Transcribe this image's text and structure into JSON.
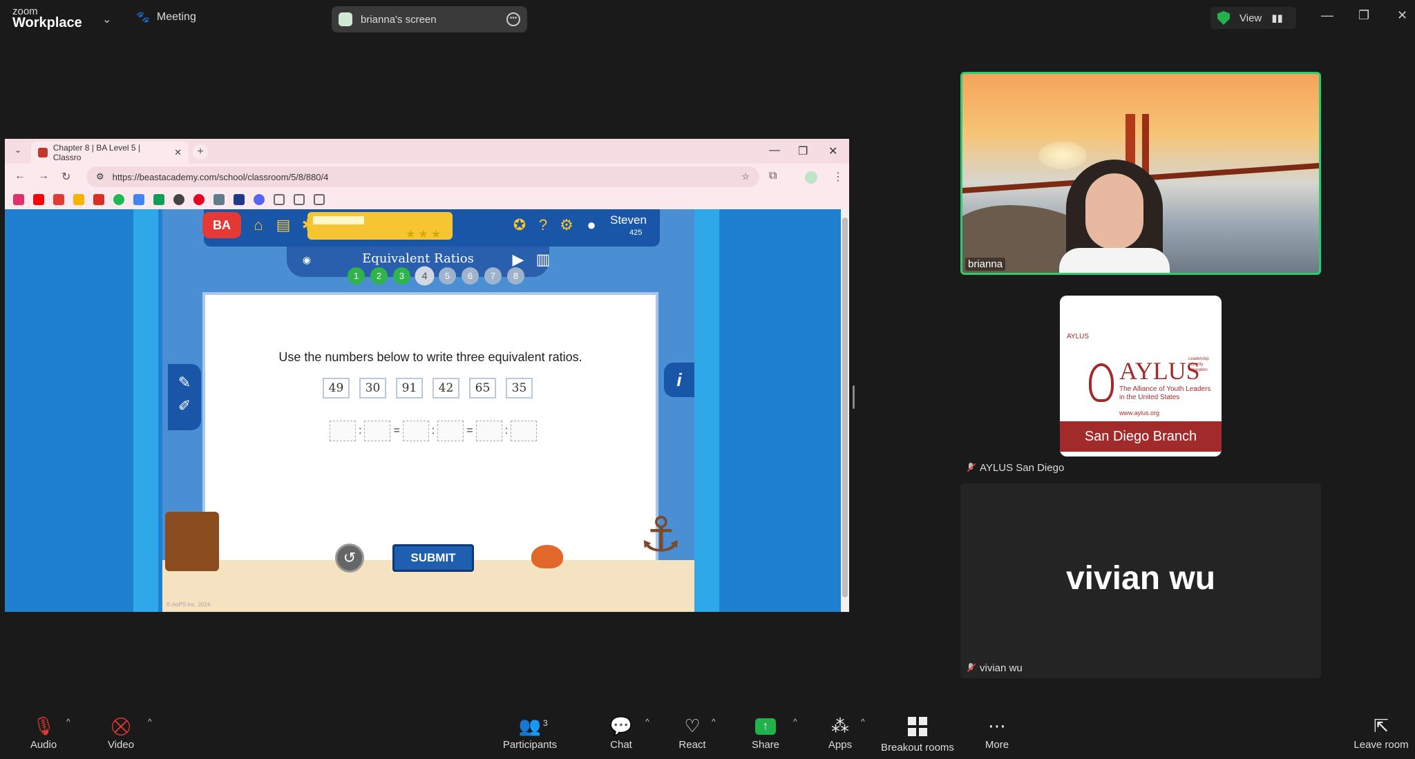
{
  "topbar": {
    "brand_small": "zoom",
    "brand_big": "Workplace",
    "meeting_label": "Meeting",
    "screen_label": "brianna's screen",
    "view_label": "View"
  },
  "browser": {
    "tab_title": "Chapter 8 | BA Level 5 | Classro",
    "url": "https://beastacademy.com/school/classroom/5/8/880/4"
  },
  "game": {
    "logo_text": "BA",
    "player_name": "Steven",
    "coins": "425",
    "title": "Equivalent Ratios",
    "progress_fraction": 0.35,
    "problem_dots": [
      {
        "label": "1",
        "state": "done"
      },
      {
        "label": "2",
        "state": "done"
      },
      {
        "label": "3",
        "state": "done"
      },
      {
        "label": "4",
        "state": "current"
      },
      {
        "label": "5",
        "state": "todo"
      },
      {
        "label": "6",
        "state": "todo"
      },
      {
        "label": "7",
        "state": "todo"
      },
      {
        "label": "8",
        "state": "todo"
      }
    ],
    "question": "Use the numbers below to write three equivalent ratios.",
    "numbers": [
      "49",
      "30",
      "91",
      "42",
      "65",
      "35"
    ],
    "submit_label": "SUBMIT",
    "info_label": "i",
    "copyright": "© AoPS Inc. 2024"
  },
  "participants": {
    "p1_name": "brianna",
    "p2_name": "AYLUS San Diego",
    "p3_name": "vivian wu",
    "p3_big": "vivian wu",
    "card": {
      "small": "AYLUS",
      "big": "AYLUS",
      "tagline": "Leadership Integrity Innovation",
      "sub": "The Alliance of Youth Leaders in the United States",
      "url": "www.aylus.org",
      "branch": "San Diego Branch"
    }
  },
  "toolbar": {
    "audio": "Audio",
    "video": "Video",
    "participants": "Participants",
    "participants_count": "3",
    "chat": "Chat",
    "react": "React",
    "share": "Share",
    "apps": "Apps",
    "breakout": "Breakout rooms",
    "more": "More",
    "leave": "Leave room"
  }
}
